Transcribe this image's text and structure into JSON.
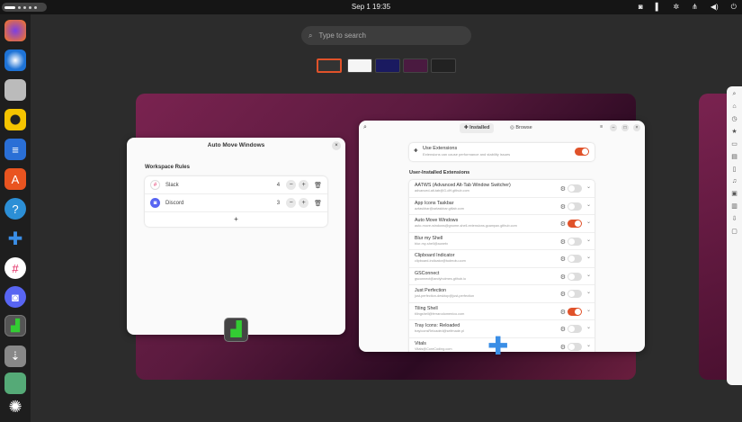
{
  "topbar": {
    "clock": "Sep 1  19:35",
    "tray": [
      "discord-icon",
      "layout-icon",
      "settings-icon",
      "network-icon",
      "volume-icon",
      "power-icon"
    ]
  },
  "dock": [
    "firefox",
    "thunderbird",
    "files",
    "rhythmbox",
    "writer",
    "app-center",
    "help",
    "extensions",
    "slack",
    "discord",
    "extension-manager",
    "usb",
    "trash",
    "ubuntu"
  ],
  "search": {
    "placeholder": "Type to search"
  },
  "amw": {
    "title": "Auto Move Windows",
    "section": "Workspace Rules",
    "rules": [
      {
        "app": "Slack",
        "workspace": "4"
      },
      {
        "app": "Discord",
        "workspace": "3"
      }
    ],
    "add": "+",
    "close": "×"
  },
  "ext": {
    "tabs": [
      "Installed",
      "Browse"
    ],
    "use_title": "Use Extensions",
    "use_sub": "Extensions can cause performance and stability issues",
    "section": "User-Installed Extensions",
    "items": [
      {
        "name": "AATWS (Advanced Alt-Tab Window Switcher)",
        "id": "advanced-alt-tab@G-dH.github.com",
        "on": false
      },
      {
        "name": "App Icons Taskbar",
        "id": "aztaskbar@aztaskbar.gitlab.com",
        "on": false
      },
      {
        "name": "Auto Move Windows",
        "id": "auto-move-windows@gnome-shell-extensions.gcampax.github.com",
        "on": true
      },
      {
        "name": "Blur my Shell",
        "id": "blur-my-shell@aunetx",
        "on": false
      },
      {
        "name": "Clipboard Indicator",
        "id": "clipboard-indicator@tudmotu.com",
        "on": false
      },
      {
        "name": "GSConnect",
        "id": "gsconnect@andyholmes.github.io",
        "on": false
      },
      {
        "name": "Just Perfection",
        "id": "just-perfection-desktop@just-perfection",
        "on": false
      },
      {
        "name": "Tiling Shell",
        "id": "tilingshell@ferrarodomenico.com",
        "on": true
      },
      {
        "name": "Tray Icons: Reloaded",
        "id": "trayIconsReloaded@selfmade.pl",
        "on": false
      },
      {
        "name": "Vitals",
        "id": "Vitals@CoreCoding.com",
        "on": false
      }
    ]
  },
  "colors": {
    "accent": "#e0522a"
  }
}
